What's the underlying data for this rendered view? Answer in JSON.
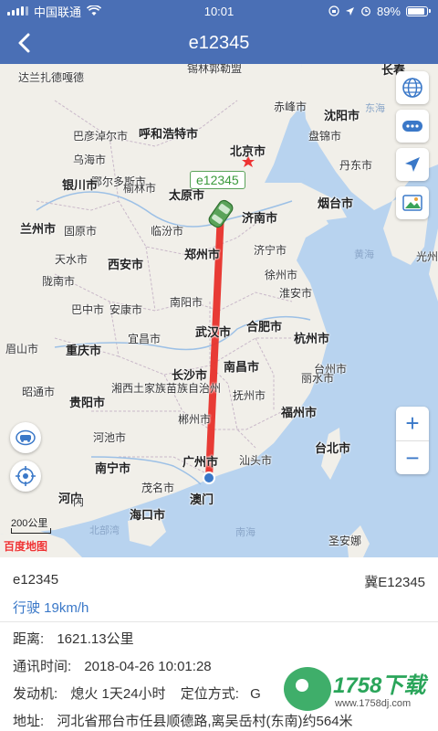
{
  "status": {
    "carrier": "中国联通",
    "time": "10:01",
    "battery": "89%",
    "battery_level": 0.89
  },
  "nav": {
    "title": "e12345"
  },
  "map": {
    "vehicle_label": "e12345",
    "scale_label": "200公里",
    "logo": "百度地图",
    "zoom_in": "+",
    "zoom_out": "−",
    "cities": [
      "达兰扎德嘎德",
      "锡林郭勒盟",
      "长春",
      "赤峰市",
      "沈阳市",
      "巴彦淖尔市",
      "呼和浩特市",
      "盘锦市",
      "乌海市",
      "北京市",
      "丹东市",
      "鄂尔多斯市",
      "银川市",
      "榆林市",
      "太原市",
      "烟台市",
      "兰州市",
      "固原市",
      "临汾市",
      "济南市",
      "郑州市",
      "济宁市",
      "天水市",
      "西安市",
      "陇南市",
      "徐州市",
      "南阳市",
      "淮安市",
      "巴中市",
      "安康市",
      "合肥市",
      "武汉市",
      "宜昌市",
      "重庆市",
      "杭州市",
      "眉山市",
      "南昌市",
      "台州市",
      "长沙市",
      "湘西土家族苗族自治州",
      "丽水市",
      "抚州市",
      "昭通市",
      "贵阳市",
      "福州市",
      "郴州市",
      "河池市",
      "台北市",
      "广州市",
      "汕头市",
      "南宁市",
      "茂名市",
      "澳门",
      "河内",
      "海口市",
      "北部湾",
      "南海",
      "圣安娜",
      "光州",
      "东海",
      "黄海",
      "内"
    ]
  },
  "info": {
    "name": "e12345",
    "plate": "冀E12345",
    "speed": "行驶 19km/h",
    "distance_label": "距离:",
    "distance_value": "1621.13公里",
    "comm_label": "通讯时间:",
    "comm_value": "2018-04-26 10:01:28",
    "engine_label": "发动机:",
    "engine_value": "熄火 1天24小时",
    "locate_label": "定位方式:",
    "locate_value": "G",
    "addr_label": "地址:",
    "addr_value": "河北省邢台市任县顺德路,离吴岳村(东南)约564米"
  },
  "watermark": {
    "text": "1758下载",
    "url": "www.1758dj.com"
  },
  "colors": {
    "header": "#4a6fb5",
    "route": "#e8322c",
    "accent": "#3a78c8",
    "sea": "#b8d3ef",
    "land": "#f1efe9"
  },
  "icons": [
    "back-icon",
    "globe-icon",
    "more-icon",
    "locate-arrow-icon",
    "map-layer-icon",
    "car-icon",
    "target-icon",
    "wifi-icon",
    "battery-icon",
    "signal-icon",
    "lock-icon",
    "alarm-icon"
  ]
}
